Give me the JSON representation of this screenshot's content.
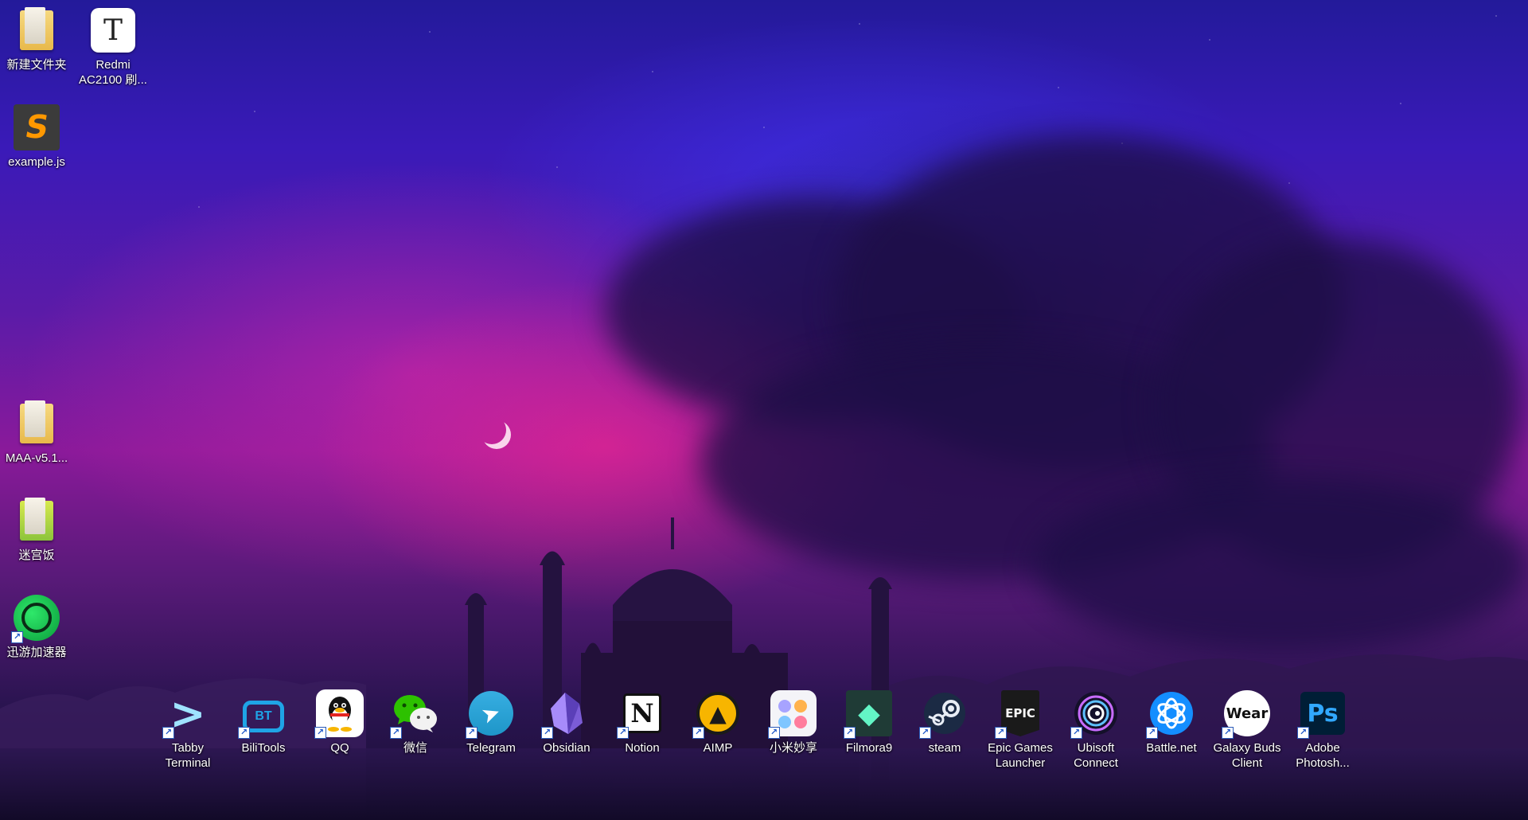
{
  "desktop_icons_left": [
    {
      "label": "新建文件夹",
      "icon": "folder-icon"
    },
    {
      "label": "Redmi\nAC2100 刷...",
      "icon": "text-document-icon",
      "glyph": "T"
    },
    {
      "label": "example.js",
      "icon": "sublime-file-icon",
      "glyph": "S"
    },
    {
      "label": "MAA-v5.1...",
      "icon": "folder-icon"
    },
    {
      "label": "迷宫饭",
      "icon": "folder-icon"
    },
    {
      "label": "迅游加速器",
      "icon": "xunyou-icon"
    }
  ],
  "dock_icons": [
    {
      "label": "Tabby\nTerminal",
      "icon": "tabby-terminal-icon",
      "glyph": ">"
    },
    {
      "label": "BiliTools",
      "icon": "bilitools-icon",
      "glyph": "BT"
    },
    {
      "label": "QQ",
      "icon": "qq-penguin-icon"
    },
    {
      "label": "微信",
      "icon": "wechat-icon"
    },
    {
      "label": "Telegram",
      "icon": "telegram-icon",
      "glyph": "➤"
    },
    {
      "label": "Obsidian",
      "icon": "obsidian-icon",
      "glyph": "◆"
    },
    {
      "label": "Notion",
      "icon": "notion-icon",
      "glyph": "N"
    },
    {
      "label": "AIMP",
      "icon": "aimp-icon",
      "glyph": "▲"
    },
    {
      "label": "小米妙享",
      "icon": "xiaomi-miaoxiang-icon"
    },
    {
      "label": "Filmora9",
      "icon": "filmora-icon",
      "glyph": "◆"
    },
    {
      "label": "steam",
      "icon": "steam-icon"
    },
    {
      "label": "Epic Games\nLauncher",
      "icon": "epic-games-icon",
      "glyph": "EPIC"
    },
    {
      "label": "Ubisoft\nConnect",
      "icon": "ubisoft-icon"
    },
    {
      "label": "Battle.net",
      "icon": "battlenet-icon"
    },
    {
      "label": "Galaxy Buds\nClient",
      "icon": "galaxy-wear-icon",
      "glyph": "Wear"
    },
    {
      "label": "Adobe\nPhotosh...",
      "icon": "photoshop-icon",
      "glyph": "Ps"
    }
  ],
  "colors": {
    "label_text": "#ffffff",
    "shortcut_blue": "#1f57c8"
  }
}
